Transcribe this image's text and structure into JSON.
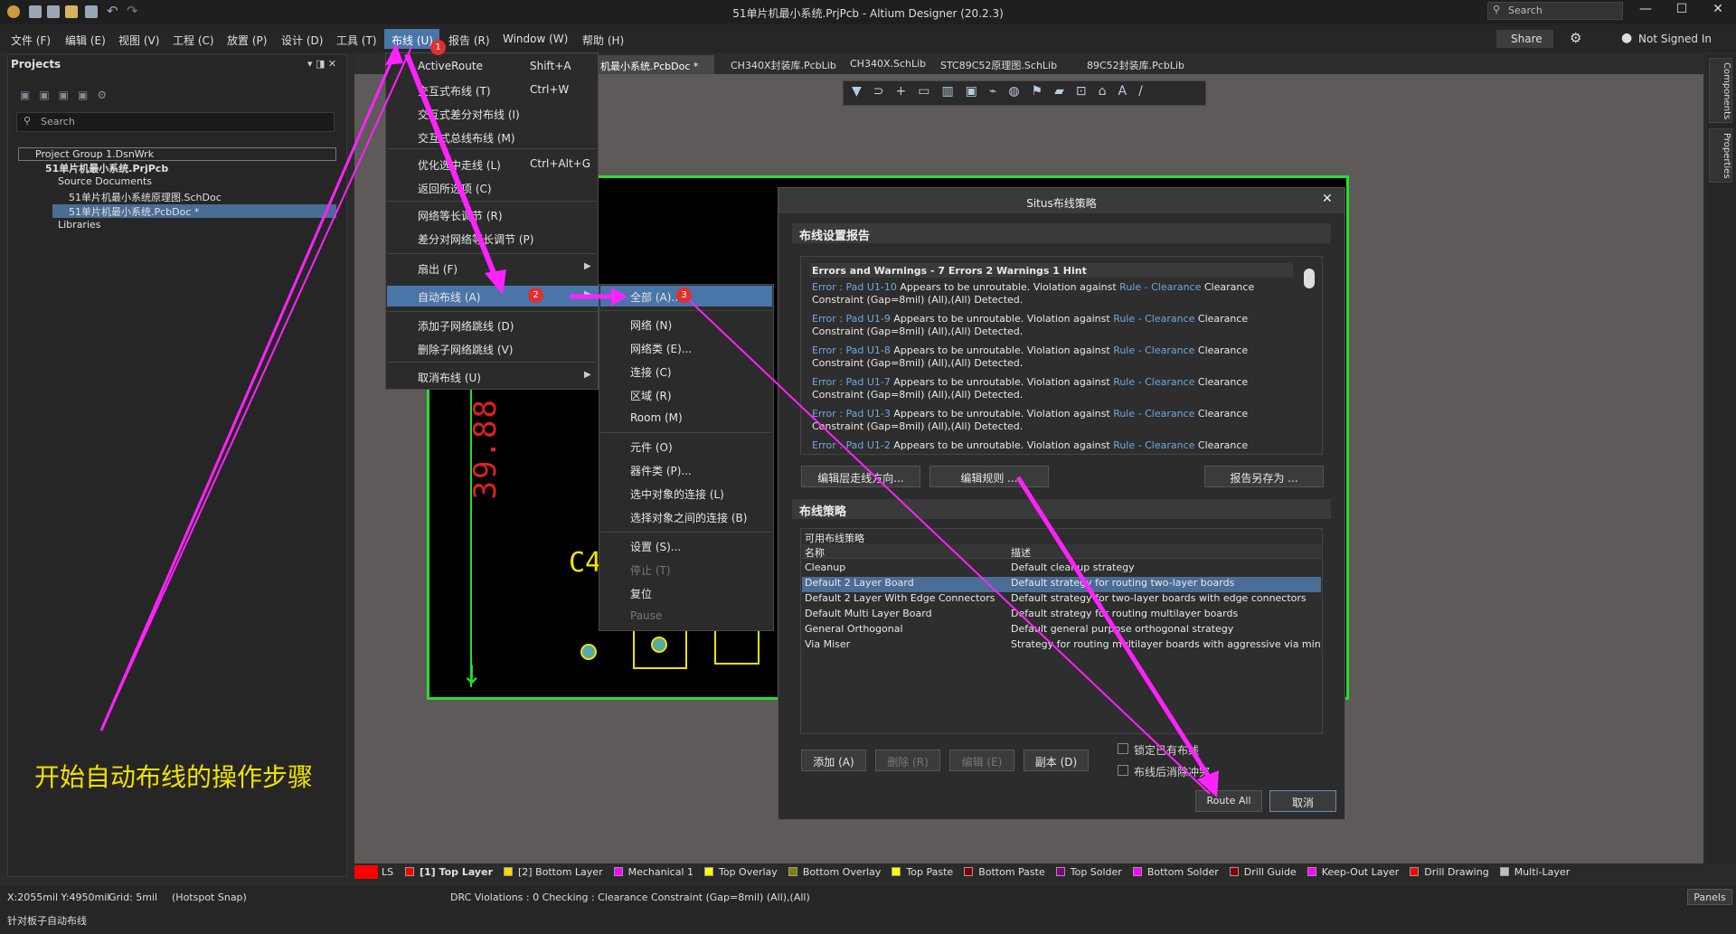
{
  "window": {
    "title": "51单片机最小系统.PrjPcb - Altium Designer (20.2.3)",
    "search_placeholder": "Search",
    "min": "—",
    "max": "☐",
    "close": "✕"
  },
  "menubar": {
    "items": [
      "文件 (F)",
      "编辑 (E)",
      "视图 (V)",
      "工程 (C)",
      "放置 (P)",
      "设计 (D)",
      "工具 (T)",
      "布线 (U)",
      "报告 (R)",
      "Window (W)",
      "帮助 (H)"
    ],
    "share": "Share",
    "user": "Not Signed In"
  },
  "projects": {
    "title": "Projects",
    "search_placeholder": "Search",
    "tree": [
      "Project Group 1.DsnWrk",
      "51单片机最小系统.PrjPcb",
      "Source Documents",
      "51单片机最小系统原理图.SchDoc",
      "51单片机最小系统.PcbDoc *",
      "Libraries"
    ]
  },
  "tabs": [
    "机最小系统.PcbDoc *",
    "CH340X封装库.PcbLib",
    "CH340X.SchLib",
    "STC89C52原理图.SchLib",
    "89C52封装库.PcbLib"
  ],
  "pcb": {
    "ruler_text": "39.88",
    "designator": "C4"
  },
  "route_menu": {
    "items": [
      {
        "label": "ActiveRoute",
        "shortcut": "Shift+A"
      },
      {
        "label": "交互式布线 (T)",
        "shortcut": "Ctrl+W"
      },
      {
        "label": "交互式差分对布线 (I)",
        "shortcut": ""
      },
      {
        "label": "交互式总线布线 (M)",
        "shortcut": ""
      },
      {
        "label": "优化选中走线 (L)",
        "shortcut": "Ctrl+Alt+G"
      },
      {
        "label": "返回所选项 (C)",
        "shortcut": ""
      },
      {
        "label": "网络等长调节 (R)",
        "shortcut": ""
      },
      {
        "label": "差分对网络等长调节 (P)",
        "shortcut": ""
      },
      {
        "label": "扇出 (F)",
        "shortcut": ""
      },
      {
        "label": "自动布线 (A)",
        "shortcut": ""
      },
      {
        "label": "添加子网络跳线 (D)",
        "shortcut": ""
      },
      {
        "label": "删除子网络跳线 (V)",
        "shortcut": ""
      },
      {
        "label": "取消布线 (U)",
        "shortcut": ""
      }
    ]
  },
  "auto_submenu": {
    "items": [
      "全部 (A)...",
      "网络 (N)",
      "网络类 (E)...",
      "连接 (C)",
      "区域 (R)",
      "Room (M)",
      "元件 (O)",
      "器件类 (P)...",
      "选中对象的连接 (L)",
      "选择对象之间的连接 (B)",
      "设置 (S)...",
      "停止 (T)",
      "复位",
      "Pause"
    ]
  },
  "badges": [
    "1",
    "2",
    "3"
  ],
  "dialog": {
    "title": "Situs布线策略",
    "report_section": "布线设置报告",
    "report_header": "Errors and Warnings - 7 Errors 2 Warnings 1 Hint",
    "report_lines": [
      "Pad U1-10",
      "Pad U1-9",
      "Pad U1-8",
      "Pad U1-7",
      "Pad U1-3",
      "Pad U1-2"
    ],
    "err_prefix": "Error",
    "err_mid": " Appears to be unroutable. Violation against ",
    "rule_link": "Rule - Clearance",
    "err_tail": " Clearance",
    "err_line2": "Constraint (Gap=8mil) (All),(All) Detected.",
    "btn_edit_dir": "编辑层走线方向...",
    "btn_edit_rules": "编辑规则 ...",
    "btn_save_report": "报告另存为 ...",
    "strategy_section": "布线策略",
    "strategy_caption": "可用布线策略",
    "col_name": "名称",
    "col_desc": "描述",
    "strategies": [
      {
        "name": "Cleanup",
        "desc": "Default cleanup strategy"
      },
      {
        "name": "Default 2 Layer Board",
        "desc": "Default strategy for routing two-layer boards"
      },
      {
        "name": "Default 2 Layer With Edge Connectors",
        "desc": "Default strategy for two-layer boards with edge connectors"
      },
      {
        "name": "Default Multi Layer Board",
        "desc": "Default strategy for routing multilayer boards"
      },
      {
        "name": "General Orthogonal",
        "desc": "Default general purpose orthogonal strategy"
      },
      {
        "name": "Via Miser",
        "desc": "Strategy for routing multilayer boards with aggressive via minimizat"
      }
    ],
    "btn_add": "添加 (A)",
    "btn_delete": "删除 (R)",
    "btn_edit": "编辑 (E)",
    "btn_copy": "副本 (D)",
    "chk_lock": "锁定已有布线",
    "chk_clear": "布线后消除冲突",
    "btn_route_all": "Route All",
    "btn_cancel": "取消"
  },
  "annotation": "开始自动布线的操作步骤",
  "layers": [
    {
      "name": "LS",
      "color": "#ff0000"
    },
    {
      "name": "[1] Top Layer",
      "color": "#ff0000"
    },
    {
      "name": "[2] Bottom Layer",
      "color": "#ffd700"
    },
    {
      "name": "Mechanical 1",
      "color": "#ff00ff"
    },
    {
      "name": "Top Overlay",
      "color": "#ffff00"
    },
    {
      "name": "Bottom Overlay",
      "color": "#808000"
    },
    {
      "name": "Top Paste",
      "color": "#ffff00"
    },
    {
      "name": "Bottom Paste",
      "color": "#800000"
    },
    {
      "name": "Top Solder",
      "color": "#800080"
    },
    {
      "name": "Bottom Solder",
      "color": "#ff00ff"
    },
    {
      "name": "Drill Guide",
      "color": "#800000"
    },
    {
      "name": "Keep-Out Layer",
      "color": "#ff00ff"
    },
    {
      "name": "Drill Drawing",
      "color": "#ff0000"
    },
    {
      "name": "Multi-Layer",
      "color": "#c0c0c0"
    }
  ],
  "status": {
    "coords": "X:2055mil Y:4950mil",
    "grid": "Grid: 5mil",
    "snap": "(Hotspot Snap)",
    "drc": "DRC Violations : 0 Checking : Clearance Constraint (Gap=8mil) (All),(All)",
    "hint": "针对板子自动布线",
    "panels": "Panels"
  },
  "side_tabs": [
    "Components",
    "Properties"
  ]
}
